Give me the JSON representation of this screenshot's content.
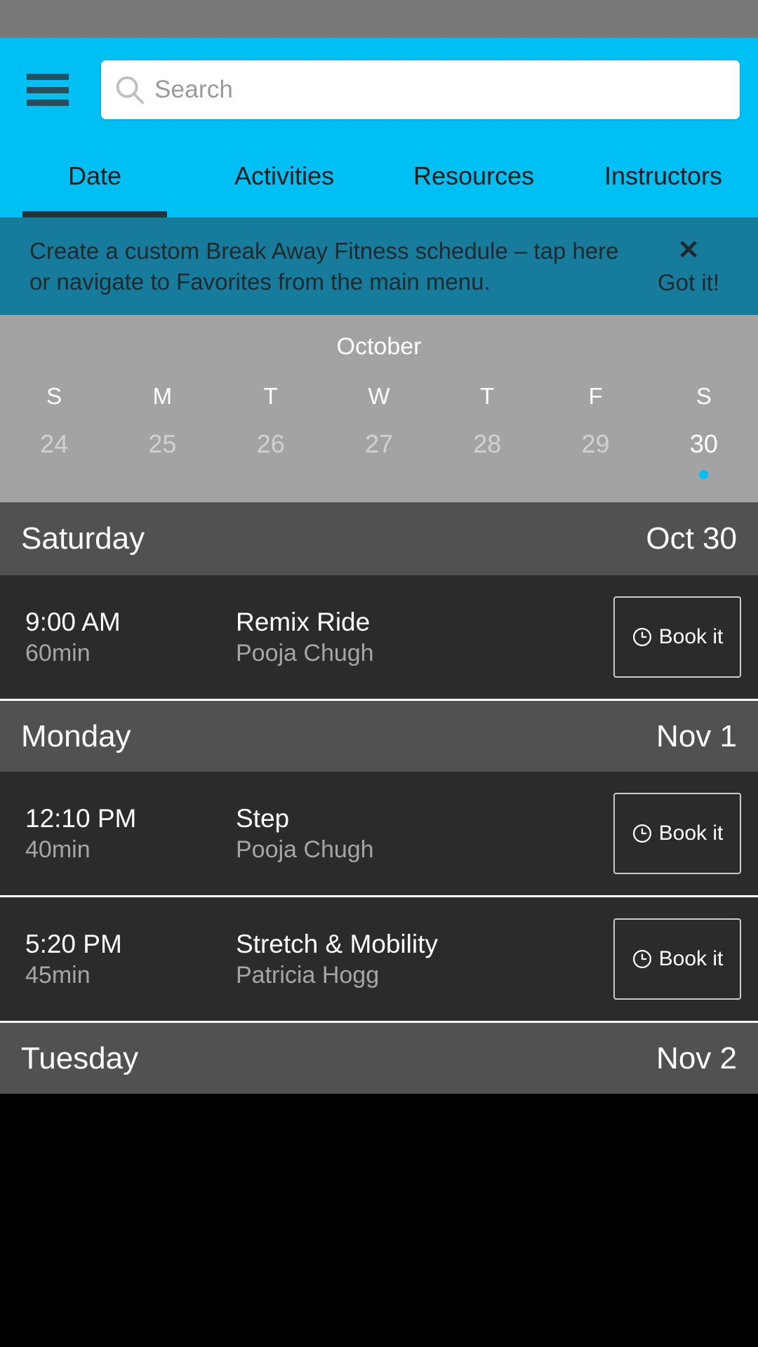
{
  "app_bar": {
    "menu_icon": "hamburger-menu-icon",
    "search": {
      "icon": "search-icon",
      "placeholder": "Search",
      "value": ""
    }
  },
  "tabs": [
    {
      "label": "Date",
      "active": true
    },
    {
      "label": "Activities",
      "active": false
    },
    {
      "label": "Resources",
      "active": false
    },
    {
      "label": "Instructors",
      "active": false
    }
  ],
  "tip_banner": {
    "message": "Create a custom Break Away Fitness schedule – tap here or navigate to Favorites from the main menu.",
    "close_icon": "close-x-icon",
    "dismiss_label": "Got it!",
    "background_color": "#177C9C"
  },
  "calendar": {
    "month": "October",
    "day_initials": [
      "S",
      "M",
      "T",
      "W",
      "T",
      "F",
      "S"
    ],
    "dates": [
      {
        "number": "24",
        "selected": false,
        "has_event": false
      },
      {
        "number": "25",
        "selected": false,
        "has_event": false
      },
      {
        "number": "26",
        "selected": false,
        "has_event": false
      },
      {
        "number": "27",
        "selected": false,
        "has_event": false
      },
      {
        "number": "28",
        "selected": false,
        "has_event": false
      },
      {
        "number": "29",
        "selected": false,
        "has_event": false
      },
      {
        "number": "30",
        "selected": true,
        "has_event": true
      }
    ],
    "selected_dot_color": "#00BFF3"
  },
  "schedule": {
    "days": [
      {
        "name": "Saturday",
        "date": "Oct 30",
        "classes": [
          {
            "time": "9:00 AM",
            "duration": "60min",
            "name": "Remix Ride",
            "instructor": "Pooja Chugh",
            "book_label": "Book it",
            "book_icon": "clock-icon"
          }
        ]
      },
      {
        "name": "Monday",
        "date": "Nov 1",
        "classes": [
          {
            "time": "12:10 PM",
            "duration": "40min",
            "name": "Step",
            "instructor": "Pooja Chugh",
            "book_label": "Book it",
            "book_icon": "clock-icon"
          },
          {
            "time": "5:20 PM",
            "duration": "45min",
            "name": "Stretch & Mobility",
            "instructor": "Patricia Hogg",
            "book_label": "Book it",
            "book_icon": "clock-icon"
          }
        ]
      },
      {
        "name": "Tuesday",
        "date": "Nov 2",
        "classes": []
      }
    ]
  },
  "colors": {
    "accent": "#00BFF3",
    "app_bar": "#00BFF3",
    "status_bar": "#787878",
    "calendar_bg": "#a3a3a3",
    "day_header_bg": "#515151",
    "class_row_bg": "#2b2b2b"
  }
}
